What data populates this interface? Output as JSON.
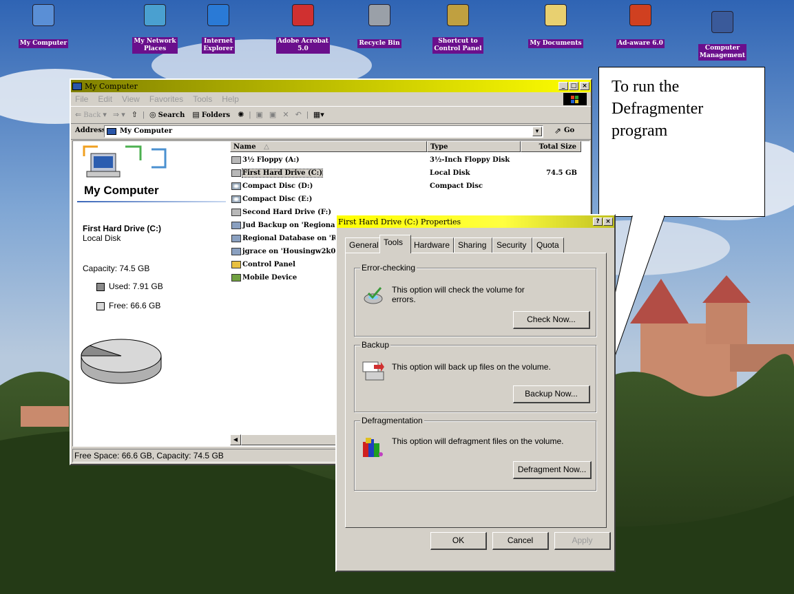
{
  "desktop_icons": [
    {
      "name": "my-computer-desktop-icon",
      "icon": "computer-icon",
      "label": "My Computer"
    },
    {
      "name": "my-network-places-desktop-icon",
      "icon": "network-icon",
      "label": "My Network\nPlaces"
    },
    {
      "name": "internet-explorer-desktop-icon",
      "icon": "ie-icon",
      "label": "Internet\nExplorer"
    },
    {
      "name": "adobe-acrobat-desktop-icon",
      "icon": "acrobat-icon",
      "label": "Adobe Acrobat\n5.0"
    },
    {
      "name": "recycle-bin-desktop-icon",
      "icon": "recycle-bin-icon",
      "label": "Recycle Bin"
    },
    {
      "name": "control-panel-shortcut-desktop-icon",
      "icon": "control-panel-icon",
      "label": "Shortcut to\nControl Panel"
    },
    {
      "name": "my-documents-desktop-icon",
      "icon": "documents-icon",
      "label": "My Documents"
    },
    {
      "name": "ad-aware-desktop-icon",
      "icon": "ad-aware-icon",
      "label": "Ad-aware 6.0"
    },
    {
      "name": "computer-management-desktop-icon",
      "icon": "computer-management-icon",
      "label": "Computer\nManagement"
    }
  ],
  "callout": {
    "text": "To run the Defragmenter program"
  },
  "mycomputer": {
    "title": "My Computer",
    "menu": [
      "File",
      "Edit",
      "View",
      "Favorites",
      "Tools",
      "Help"
    ],
    "toolbar": {
      "back": "Back",
      "search": "Search",
      "folders": "Folders"
    },
    "address_label": "Address",
    "address_value": "My Computer",
    "go_label": "Go",
    "left_heading": "My Computer",
    "drive_name": "First Hard Drive (C:)",
    "drive_type": "Local Disk",
    "capacity": "Capacity: 74.5 GB",
    "used": "Used: 7.91 GB",
    "free": "Free: 66.6 GB",
    "used_fraction": 0.106,
    "columns": [
      "Name",
      "Type",
      "Total Size"
    ],
    "items": [
      {
        "name": "3½ Floppy (A:)",
        "type": "3½-Inch Floppy Disk",
        "size": "",
        "icon": "floppy-drive-icon",
        "selected": false
      },
      {
        "name": "First Hard Drive (C:)",
        "type": "Local Disk",
        "size": "74.5 GB",
        "icon": "hard-drive-icon",
        "selected": true
      },
      {
        "name": "Compact Disc (D:)",
        "type": "Compact Disc",
        "size": "",
        "icon": "cd-drive-icon",
        "selected": false
      },
      {
        "name": "Compact Disc (E:)",
        "type": "",
        "size": "",
        "icon": "cd-drive-icon",
        "selected": false
      },
      {
        "name": "Second Hard Drive (F:)",
        "type": "",
        "size": "",
        "icon": "hard-drive-icon",
        "selected": false
      },
      {
        "name": "Jud Backup on 'Regionalse",
        "type": "",
        "size": "",
        "icon": "network-drive-icon",
        "selected": false
      },
      {
        "name": "Regional Database on 'Rep",
        "type": "",
        "size": "",
        "icon": "network-drive-icon",
        "selected": false
      },
      {
        "name": "jgrace on 'Housingw2k01'",
        "type": "",
        "size": "",
        "icon": "network-drive-icon",
        "selected": false
      },
      {
        "name": "Control Panel",
        "type": "",
        "size": "",
        "icon": "control-panel-icon",
        "selected": false
      },
      {
        "name": "Mobile Device",
        "type": "",
        "size": "",
        "icon": "mobile-device-icon",
        "selected": false
      }
    ],
    "status": "Free Space: 66.6 GB, Capacity: 74.5 GB"
  },
  "props": {
    "title": "First Hard Drive (C:) Properties",
    "tabs": [
      "General",
      "Tools",
      "Hardware",
      "Sharing",
      "Security",
      "Quota"
    ],
    "active_tab": "Tools",
    "error_title": "Error-checking",
    "error_text": "This option will check the volume for errors.",
    "check_btn": "Check Now...",
    "backup_title": "Backup",
    "backup_text": "This option will back up files on the volume.",
    "backup_btn": "Backup Now...",
    "defrag_title": "Defragmentation",
    "defrag_text": "This option will defragment files on the volume.",
    "defrag_btn": "Defragment Now...",
    "ok": "OK",
    "cancel": "Cancel",
    "apply": "Apply"
  },
  "colors": {
    "title_gradient_start": "#808000",
    "title_gradient_end": "#ffff00",
    "icon_label_bg": "#6a0f8c",
    "selection": "#d4d0c8"
  }
}
